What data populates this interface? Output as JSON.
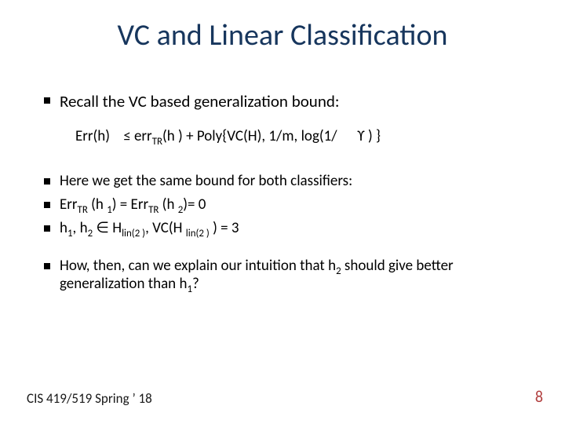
{
  "title": "VC and Linear Classification",
  "bullets": {
    "b1": "Recall the VC based generalization bound:",
    "formula": {
      "lhs": "Err(h)",
      "leq_html": "≤ err<sub>TR</sub>(h ) + Poly{VC(H), 1/m, log(1/",
      "tail": "ϒ ) }"
    },
    "b2_html": "Here we get the same bound for both classifiers:",
    "b3_html": "Err<sub>TR</sub> (h <sub>1</sub>) =  Err<sub>TR</sub> (h <sub>2</sub>)= 0",
    "b4_html": "h<sub>1</sub>, h<sub>2</sub> ∈ H<sub>lin(2 )</sub>, VC(H <sub>lin(2 )</sub> ) =  3",
    "b5_html": "How, then, can we explain our intuition that   h<sub>2</sub> should give better generalization than  h<sub>1</sub>?"
  },
  "footer": {
    "left": "CIS 419/519 Spring ’ 18",
    "right": "8"
  }
}
